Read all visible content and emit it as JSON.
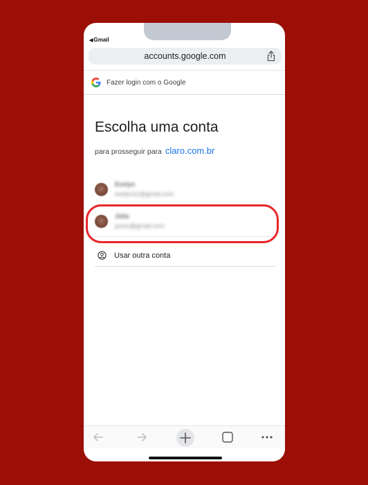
{
  "status_bar": {
    "back_app": "Gmail"
  },
  "browser": {
    "url": "accounts.google.com"
  },
  "google_header": {
    "text": "Fazer login com o Google"
  },
  "main": {
    "title": "Escolha uma conta",
    "subtitle_prefix": "para prosseguir para",
    "subtitle_link": "claro.com.br"
  },
  "accounts": [
    {
      "name": "Evelyn",
      "email": "evelyn11@gmail.com"
    },
    {
      "name": "Júlia",
      "email": "jusou@gmail.com"
    }
  ],
  "other_account": {
    "label": "Usar outra conta"
  },
  "colors": {
    "background": "#9c0f06",
    "highlight": "#e8262a",
    "link": "#1a73e8"
  },
  "icons": [
    "back-arrow-icon",
    "share-icon",
    "google-logo-icon",
    "person-circle-icon",
    "nav-back-icon",
    "nav-forward-icon",
    "new-tab-plus-icon",
    "tabs-icon",
    "more-icon"
  ]
}
